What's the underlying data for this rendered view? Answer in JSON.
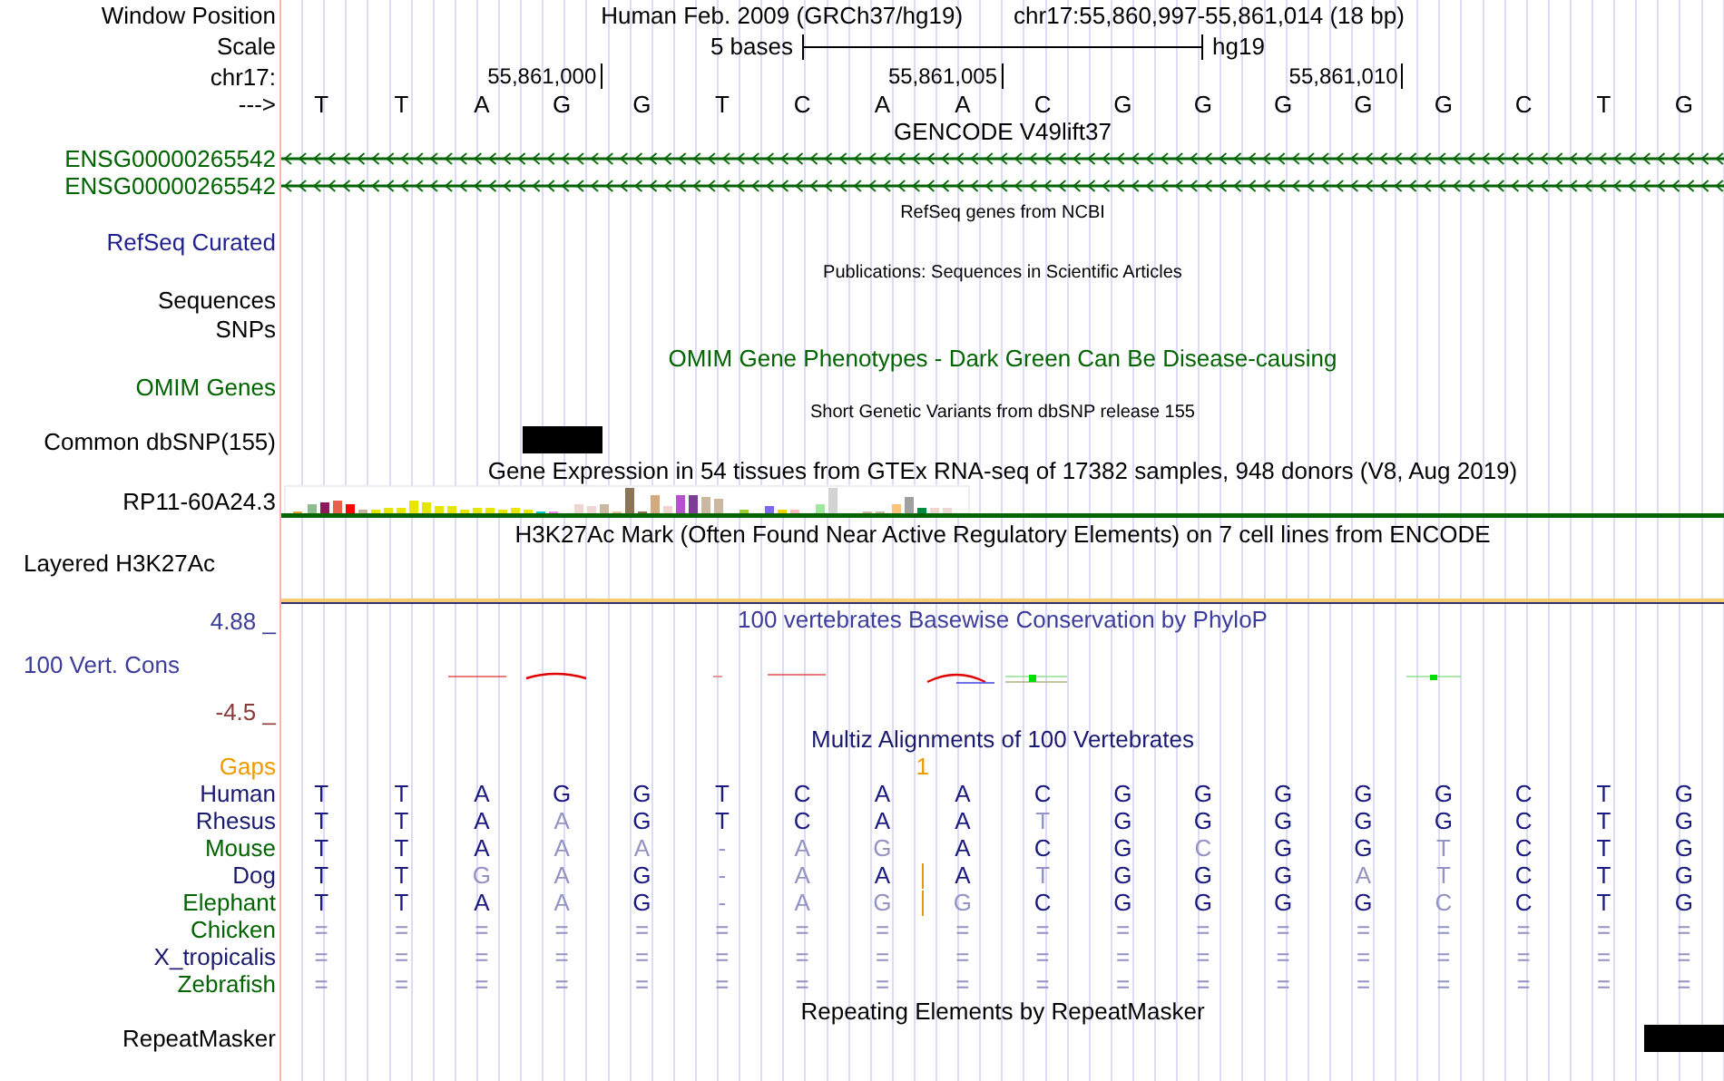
{
  "header": {
    "position_label": "Window Position",
    "assembly": "Human Feb. 2009 (GRCh37/hg19)",
    "position": "chr17:55,860,997-55,861,014 (18 bp)",
    "scale_label": "Scale",
    "scale_text": "5 bases",
    "scale_db": "hg19",
    "chrom_label": "chr17:",
    "ticks": [
      "55,861,000",
      "55,861,005",
      "55,861,010"
    ],
    "strand_label": "--->",
    "bases": [
      "T",
      "T",
      "A",
      "G",
      "G",
      "T",
      "C",
      "A",
      "A",
      "C",
      "G",
      "G",
      "G",
      "G",
      "G",
      "C",
      "T",
      "G"
    ]
  },
  "gencode": {
    "title": "GENCODE V49lift37",
    "genes": [
      {
        "label": "ENSG00000265542",
        "color": "#006400"
      },
      {
        "label": "ENSG00000265542",
        "color": "#006400"
      }
    ]
  },
  "refseq": {
    "title": "RefSeq genes from NCBI",
    "label": "RefSeq Curated"
  },
  "publications": {
    "title": "Publications: Sequences in Scientific Articles",
    "label": "Sequences"
  },
  "snps": {
    "label": "SNPs"
  },
  "omim": {
    "title": "OMIM Gene Phenotypes - Dark Green Can Be Disease-causing",
    "label": "OMIM Genes"
  },
  "dbsnp": {
    "title": "Short Genetic Variants from dbSNP release 155",
    "label": "Common dbSNP(155)"
  },
  "gtex": {
    "title": "Gene Expression in 54 tissues from GTEx RNA-seq of 17382 samples, 948 donors (V8, Aug 2019)",
    "label": "RP11-60A24.3"
  },
  "h3k27ac": {
    "title": "H3K27Ac Mark (Often Found Near Active Regulatory Elements) on 7 cell lines from ENCODE",
    "label": "Layered H3K27Ac"
  },
  "conservation": {
    "title": "100 vertebrates Basewise Conservation by PhyloP",
    "label": "100 Vert. Cons",
    "max": "4.88 _",
    "min": "-4.5 _"
  },
  "multiz": {
    "title": "Multiz Alignments of 100 Vertebrates",
    "gaps_label": "Gaps",
    "gap_count": "1",
    "species": [
      {
        "name": "Human",
        "color": "#191970",
        "insertion": false,
        "bases": [
          {
            "base": "T",
            "faded": false
          },
          {
            "base": "T",
            "faded": false
          },
          {
            "base": "A",
            "faded": false
          },
          {
            "base": "G",
            "faded": false
          },
          {
            "base": "G",
            "faded": false
          },
          {
            "base": "T",
            "faded": false
          },
          {
            "base": "C",
            "faded": false
          },
          {
            "base": "A",
            "faded": false
          },
          {
            "base": "A",
            "faded": false
          },
          {
            "base": "C",
            "faded": false
          },
          {
            "base": "G",
            "faded": false
          },
          {
            "base": "G",
            "faded": false
          },
          {
            "base": "G",
            "faded": false
          },
          {
            "base": "G",
            "faded": false
          },
          {
            "base": "G",
            "faded": false
          },
          {
            "base": "C",
            "faded": false
          },
          {
            "base": "T",
            "faded": false
          },
          {
            "base": "G",
            "faded": false
          }
        ]
      },
      {
        "name": "Rhesus",
        "color": "#191970",
        "insertion": false,
        "bases": [
          {
            "base": "T",
            "faded": false
          },
          {
            "base": "T",
            "faded": false
          },
          {
            "base": "A",
            "faded": false
          },
          {
            "base": "A",
            "faded": true
          },
          {
            "base": "G",
            "faded": false
          },
          {
            "base": "T",
            "faded": false
          },
          {
            "base": "C",
            "faded": false
          },
          {
            "base": "A",
            "faded": false
          },
          {
            "base": "A",
            "faded": false
          },
          {
            "base": "T",
            "faded": true
          },
          {
            "base": "G",
            "faded": false
          },
          {
            "base": "G",
            "faded": false
          },
          {
            "base": "G",
            "faded": false
          },
          {
            "base": "G",
            "faded": false
          },
          {
            "base": "G",
            "faded": false
          },
          {
            "base": "C",
            "faded": false
          },
          {
            "base": "T",
            "faded": false
          },
          {
            "base": "G",
            "faded": false
          }
        ]
      },
      {
        "name": "Mouse",
        "color": "#006400",
        "insertion": false,
        "bases": [
          {
            "base": "T",
            "faded": false
          },
          {
            "base": "T",
            "faded": false
          },
          {
            "base": "A",
            "faded": false
          },
          {
            "base": "A",
            "faded": true
          },
          {
            "base": "A",
            "faded": true
          },
          {
            "base": "-",
            "faded": true
          },
          {
            "base": "A",
            "faded": true
          },
          {
            "base": "G",
            "faded": true
          },
          {
            "base": "A",
            "faded": false
          },
          {
            "base": "C",
            "faded": false
          },
          {
            "base": "G",
            "faded": false
          },
          {
            "base": "C",
            "faded": true
          },
          {
            "base": "G",
            "faded": false
          },
          {
            "base": "G",
            "faded": false
          },
          {
            "base": "T",
            "faded": true
          },
          {
            "base": "C",
            "faded": false
          },
          {
            "base": "T",
            "faded": false
          },
          {
            "base": "G",
            "faded": false
          }
        ]
      },
      {
        "name": "Dog",
        "color": "#191970",
        "insertion": true,
        "bases": [
          {
            "base": "T",
            "faded": false
          },
          {
            "base": "T",
            "faded": false
          },
          {
            "base": "G",
            "faded": true
          },
          {
            "base": "A",
            "faded": true
          },
          {
            "base": "G",
            "faded": false
          },
          {
            "base": "-",
            "faded": true
          },
          {
            "base": "A",
            "faded": true
          },
          {
            "base": "A",
            "faded": false
          },
          {
            "base": "A",
            "faded": false
          },
          {
            "base": "T",
            "faded": true
          },
          {
            "base": "G",
            "faded": false
          },
          {
            "base": "G",
            "faded": false
          },
          {
            "base": "G",
            "faded": false
          },
          {
            "base": "A",
            "faded": true
          },
          {
            "base": "T",
            "faded": true
          },
          {
            "base": "C",
            "faded": false
          },
          {
            "base": "T",
            "faded": false
          },
          {
            "base": "G",
            "faded": false
          }
        ]
      },
      {
        "name": "Elephant",
        "color": "#006400",
        "insertion": true,
        "bases": [
          {
            "base": "T",
            "faded": false
          },
          {
            "base": "T",
            "faded": false
          },
          {
            "base": "A",
            "faded": false
          },
          {
            "base": "A",
            "faded": true
          },
          {
            "base": "G",
            "faded": false
          },
          {
            "base": "-",
            "faded": true
          },
          {
            "base": "A",
            "faded": true
          },
          {
            "base": "G",
            "faded": true
          },
          {
            "base": "G",
            "faded": true
          },
          {
            "base": "C",
            "faded": false
          },
          {
            "base": "G",
            "faded": false
          },
          {
            "base": "G",
            "faded": false
          },
          {
            "base": "G",
            "faded": false
          },
          {
            "base": "G",
            "faded": false
          },
          {
            "base": "C",
            "faded": true
          },
          {
            "base": "C",
            "faded": false
          },
          {
            "base": "T",
            "faded": false
          },
          {
            "base": "G",
            "faded": false
          }
        ]
      },
      {
        "name": "Chicken",
        "color": "#006400",
        "insertion": false,
        "bases": [
          {
            "base": "=",
            "faded": true
          },
          {
            "base": "=",
            "faded": true
          },
          {
            "base": "=",
            "faded": true
          },
          {
            "base": "=",
            "faded": true
          },
          {
            "base": "=",
            "faded": true
          },
          {
            "base": "=",
            "faded": true
          },
          {
            "base": "=",
            "faded": true
          },
          {
            "base": "=",
            "faded": true
          },
          {
            "base": "=",
            "faded": true
          },
          {
            "base": "=",
            "faded": true
          },
          {
            "base": "=",
            "faded": true
          },
          {
            "base": "=",
            "faded": true
          },
          {
            "base": "=",
            "faded": true
          },
          {
            "base": "=",
            "faded": true
          },
          {
            "base": "=",
            "faded": true
          },
          {
            "base": "=",
            "faded": true
          },
          {
            "base": "=",
            "faded": true
          },
          {
            "base": "=",
            "faded": true
          }
        ]
      },
      {
        "name": "X_tropicalis",
        "color": "#191970",
        "insertion": false,
        "bases": [
          {
            "base": "=",
            "faded": true
          },
          {
            "base": "=",
            "faded": true
          },
          {
            "base": "=",
            "faded": true
          },
          {
            "base": "=",
            "faded": true
          },
          {
            "base": "=",
            "faded": true
          },
          {
            "base": "=",
            "faded": true
          },
          {
            "base": "=",
            "faded": true
          },
          {
            "base": "=",
            "faded": true
          },
          {
            "base": "=",
            "faded": true
          },
          {
            "base": "=",
            "faded": true
          },
          {
            "base": "=",
            "faded": true
          },
          {
            "base": "=",
            "faded": true
          },
          {
            "base": "=",
            "faded": true
          },
          {
            "base": "=",
            "faded": true
          },
          {
            "base": "=",
            "faded": true
          },
          {
            "base": "=",
            "faded": true
          },
          {
            "base": "=",
            "faded": true
          },
          {
            "base": "=",
            "faded": true
          }
        ]
      },
      {
        "name": "Zebrafish",
        "color": "#006400",
        "insertion": false,
        "bases": [
          {
            "base": "=",
            "faded": true
          },
          {
            "base": "=",
            "faded": true
          },
          {
            "base": "=",
            "faded": true
          },
          {
            "base": "=",
            "faded": true
          },
          {
            "base": "=",
            "faded": true
          },
          {
            "base": "=",
            "faded": true
          },
          {
            "base": "=",
            "faded": true
          },
          {
            "base": "=",
            "faded": true
          },
          {
            "base": "=",
            "faded": true
          },
          {
            "base": "=",
            "faded": true
          },
          {
            "base": "=",
            "faded": true
          },
          {
            "base": "=",
            "faded": true
          },
          {
            "base": "=",
            "faded": true
          },
          {
            "base": "=",
            "faded": true
          },
          {
            "base": "=",
            "faded": true
          },
          {
            "base": "=",
            "faded": true
          },
          {
            "base": "=",
            "faded": true
          },
          {
            "base": "=",
            "faded": true
          }
        ]
      }
    ]
  },
  "repeatmasker": {
    "title": "Repeating Elements by RepeatMasker",
    "label": "RepeatMasker"
  }
}
